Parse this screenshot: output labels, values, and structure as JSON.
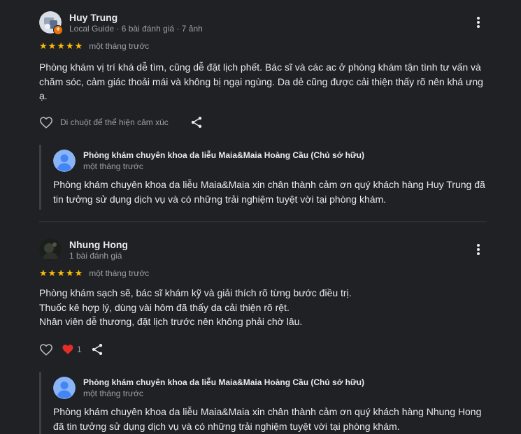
{
  "reviews": [
    {
      "name": "Huy Trung",
      "meta": "Local Guide · 6 bài đánh giá · 7 ảnh",
      "rating": 5,
      "date": "một tháng trước",
      "text": [
        "Phòng khám vị trí khá dễ tìm, cũng dễ đặt lịch phết. Bác sĩ và các ac ở phòng khám tận tình tư vấn và chăm sóc, cảm giác thoải mái và không bị ngại ngùng. Da dẻ cũng được cải thiện thấy rõ nên khá ưng ạ."
      ],
      "reaction_hint": "Di chuột để thể hiện cảm xúc",
      "owner_reply": {
        "name": "Phòng khám chuyên khoa da liễu Maia&Maia Hoàng Cầu (Chủ sở hữu)",
        "date": "một tháng trước",
        "text": "Phòng khám chuyên khoa da liễu Maia&Maia xin chân thành cảm ơn quý khách hàng Huy Trung đã tin tưởng sử dụng dịch vụ và có những trải nghiệm tuyệt vời tại phòng khám."
      }
    },
    {
      "name": "Nhung Hong",
      "meta": "1 bài đánh giá",
      "rating": 5,
      "date": "một tháng trước",
      "text": [
        "Phòng khám sạch sẽ, bác sĩ khám kỹ và giải thích rõ từng bước điều trị.",
        "Thuốc kê hợp lý, dùng vài hôm đã thấy da cải thiện rõ rệt.",
        "Nhân viên dễ thương, đặt lịch trước nên không phải chờ lâu."
      ],
      "reaction_count": "1",
      "owner_reply": {
        "name": "Phòng khám chuyên khoa da liễu Maia&Maia Hoàng Cầu (Chủ sở hữu)",
        "date": "một tháng trước",
        "text": "Phòng khám chuyên khoa da liễu Maia&Maia xin chân thành cảm ơn quý khách hàng Nhung Hong đã tin tưởng sử dụng dịch vụ và có những trải nghiệm tuyệt vời tại phòng khám."
      }
    }
  ],
  "icons": {
    "more": "more-vert-icon",
    "like": "heart-outline-icon",
    "share": "share-icon",
    "reaction": "red-heart-icon",
    "local_guide_badge": "local-guide-badge-icon",
    "owner_avatar": "default-user-avatar-icon"
  },
  "colors": {
    "background": "#202124",
    "star": "#fbbc04",
    "owner_avatar": "#8ab4f8",
    "reaction_heart": "#e52d27",
    "badge": "#e8710a"
  }
}
